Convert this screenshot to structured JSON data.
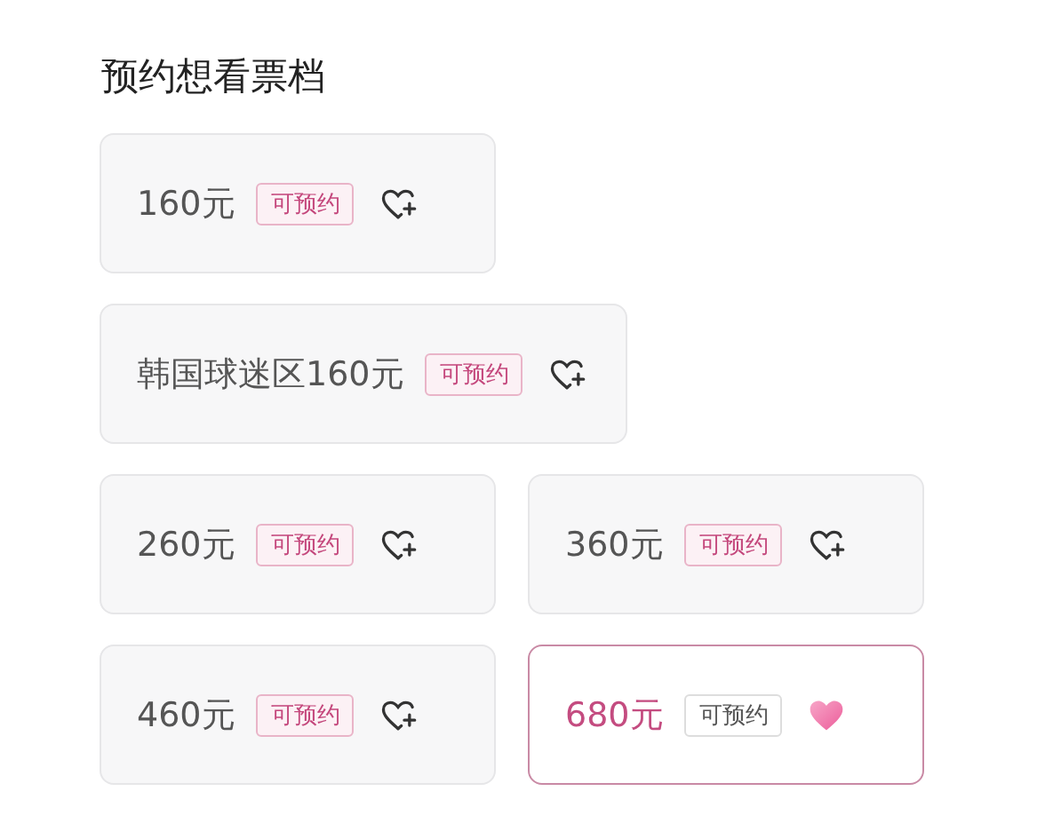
{
  "title": "预约想看票档",
  "tiers": [
    {
      "price": "160元",
      "badge": "可预约",
      "selected": false
    },
    {
      "price": "韩国球迷区160元",
      "badge": "可预约",
      "selected": false
    },
    {
      "price": "260元",
      "badge": "可预约",
      "selected": false
    },
    {
      "price": "360元",
      "badge": "可预约",
      "selected": false
    },
    {
      "price": "460元",
      "badge": "可预约",
      "selected": false
    },
    {
      "price": "680元",
      "badge": "可预约",
      "selected": true
    }
  ]
}
